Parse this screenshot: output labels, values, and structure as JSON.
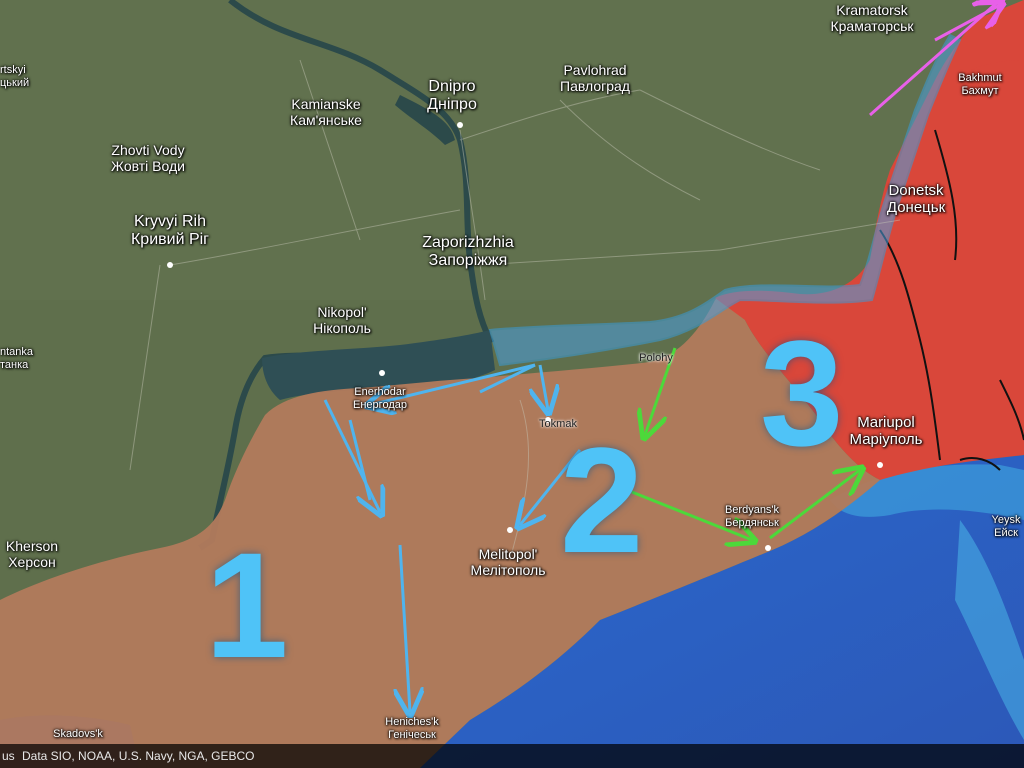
{
  "colors": {
    "land": "#5f6f4c",
    "occupied_south": "#b87a5e",
    "occupied_east": "#d9473a",
    "front_line": "#3a9bd8",
    "sea": "#2a63c8",
    "arrow_blue": "#4fb4ee",
    "arrow_green": "#4cd93a",
    "arrow_pink": "#e860e8"
  },
  "cities": [
    {
      "id": "kramatorsk",
      "latin": "Kramatorsk",
      "cyrillic": "Краматорськ"
    },
    {
      "id": "bakhmut",
      "latin": "Bakhmut",
      "cyrillic": "Бахмут"
    },
    {
      "id": "dnipro",
      "latin": "Dnipro",
      "cyrillic": "Дніпро"
    },
    {
      "id": "pavlohrad",
      "latin": "Pavlohrad",
      "cyrillic": "Павлоград"
    },
    {
      "id": "kamianske",
      "latin": "Kamianske",
      "cyrillic": "Кам'янське"
    },
    {
      "id": "zhovti-vody",
      "latin": "Zhovti Vody",
      "cyrillic": "Жовті Води"
    },
    {
      "id": "kryvyi-rih",
      "latin": "Kryvyi Rih",
      "cyrillic": "Кривий Ріг"
    },
    {
      "id": "zaporizhzhia",
      "latin": "Zaporizhzhia",
      "cyrillic": "Запоріжжя"
    },
    {
      "id": "donetsk",
      "latin": "Donetsk",
      "cyrillic": "Донецьк"
    },
    {
      "id": "nikopol",
      "latin": "Nikopol'",
      "cyrillic": "Нікополь"
    },
    {
      "id": "polohy",
      "latin": "Polohy",
      "cyrillic": ""
    },
    {
      "id": "enerhodar",
      "latin": "Enerhodar",
      "cyrillic": "Енергодар"
    },
    {
      "id": "tokmak",
      "latin": "Tokmak",
      "cyrillic": ""
    },
    {
      "id": "mariupol",
      "latin": "Mariupol",
      "cyrillic": "Маріуполь"
    },
    {
      "id": "melitopol",
      "latin": "Melitopol'",
      "cyrillic": "Мелітополь"
    },
    {
      "id": "berdyansk",
      "latin": "Berdyans'k",
      "cyrillic": "Бердянськ"
    },
    {
      "id": "kherson",
      "latin": "Kherson",
      "cyrillic": "Херсон"
    },
    {
      "id": "yeysk",
      "latin": "Yeysk",
      "cyrillic": "Ейск"
    },
    {
      "id": "henichesk",
      "latin": "Heniches'k",
      "cyrillic": "Генічеськ"
    },
    {
      "id": "skadovsk",
      "latin": "Skadovs'k",
      "cyrillic": ""
    },
    {
      "id": "left-top",
      "latin": "rtskyi",
      "cyrillic": "цький"
    },
    {
      "id": "left-mid",
      "latin": "ntanka",
      "cyrillic": "танка"
    }
  ],
  "direction_labels": [
    "1",
    "2",
    "3"
  ],
  "footer": {
    "left_text": "us",
    "credit": "Data SIO, NOAA, U.S. Navy, NGA, GEBCO"
  }
}
